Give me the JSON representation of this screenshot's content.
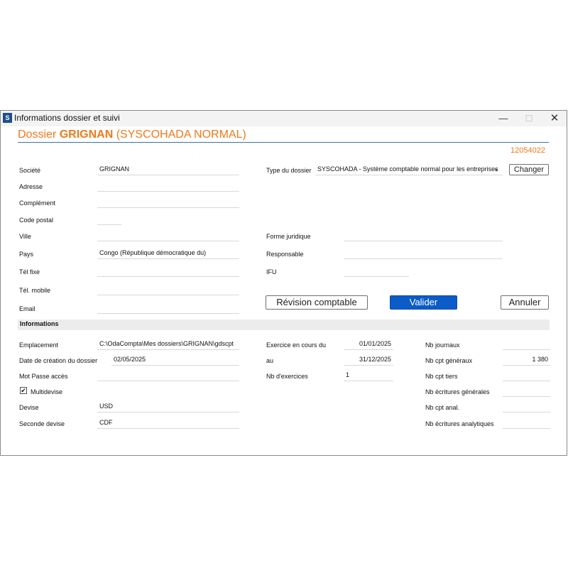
{
  "window": {
    "title": "Informations dossier et suivi",
    "app_icon": "S",
    "minimize": "—",
    "maximize": "☐",
    "close": "✕"
  },
  "header": {
    "prefix": "Dossier ",
    "name": "GRIGNAN",
    "suffix": " (SYSCOHADA NORMAL)",
    "code": "12054022"
  },
  "left_fields": {
    "societe": {
      "label": "Société",
      "value": "GRIGNAN"
    },
    "adresse": {
      "label": "Adresse",
      "value": ""
    },
    "complement": {
      "label": "Complément",
      "value": ""
    },
    "code_postal": {
      "label": "Code postal",
      "value": ""
    },
    "ville": {
      "label": "Ville",
      "value": ""
    },
    "pays": {
      "label": "Pays",
      "value": "Congo (République démocratique du)"
    },
    "tel_fixe": {
      "label": "Tél fixe",
      "value": ""
    },
    "tel_mobile": {
      "label": "Tél. mobile",
      "value": ""
    },
    "email": {
      "label": "Email",
      "value": ""
    }
  },
  "right_fields": {
    "type_dossier": {
      "label": "Type du dossier",
      "value": "SYSCOHADA - Système comptable normal pour les entreprises"
    },
    "forme_juridique": {
      "label": "Forme juridique",
      "value": ""
    },
    "responsable": {
      "label": "Responsable",
      "value": ""
    },
    "ifu": {
      "label": "IFU",
      "value": ""
    }
  },
  "buttons": {
    "changer": "Changer",
    "revision": "Révision comptable",
    "valider": "Valider",
    "annuler": "Annuler"
  },
  "informations": {
    "section_title": "Informations",
    "emplacement": {
      "label": "Emplacement",
      "value": "C:\\OdaCompta\\Mes dossiers\\GRIGNAN\\gdscpt"
    },
    "date_creation": {
      "label": "Date de création du dossier",
      "value": "02/05/2025"
    },
    "mot_passe": {
      "label": "Mot Passe accès",
      "value": ""
    },
    "multidevise": {
      "label": "Multidevise",
      "checked": true,
      "check_glyph": "✔"
    },
    "devise": {
      "label": "Devise",
      "value": "USD"
    },
    "seconde_devise": {
      "label": "Seconde devise",
      "value": "CDF"
    },
    "exercice_du": {
      "label": "Exercice en cours du",
      "value": "01/01/2025"
    },
    "exercice_au": {
      "label": "au",
      "value": "31/12/2025"
    },
    "nb_exercices": {
      "label": "Nb d'exercices",
      "value": "1"
    },
    "nb_journaux": {
      "label": "Nb journaux",
      "value": ""
    },
    "nb_cpt_generaux": {
      "label": "Nb cpt généraux",
      "value": "1 380"
    },
    "nb_cpt_tiers": {
      "label": "Nb cpt tiers",
      "value": ""
    },
    "nb_ecritures_generales": {
      "label": "Nb écritures générales",
      "value": ""
    },
    "nb_cpt_anal": {
      "label": "Nb cpt anal.",
      "value": ""
    },
    "nb_ecritures_analytiques": {
      "label": "Nb écritures analytiques",
      "value": ""
    }
  }
}
